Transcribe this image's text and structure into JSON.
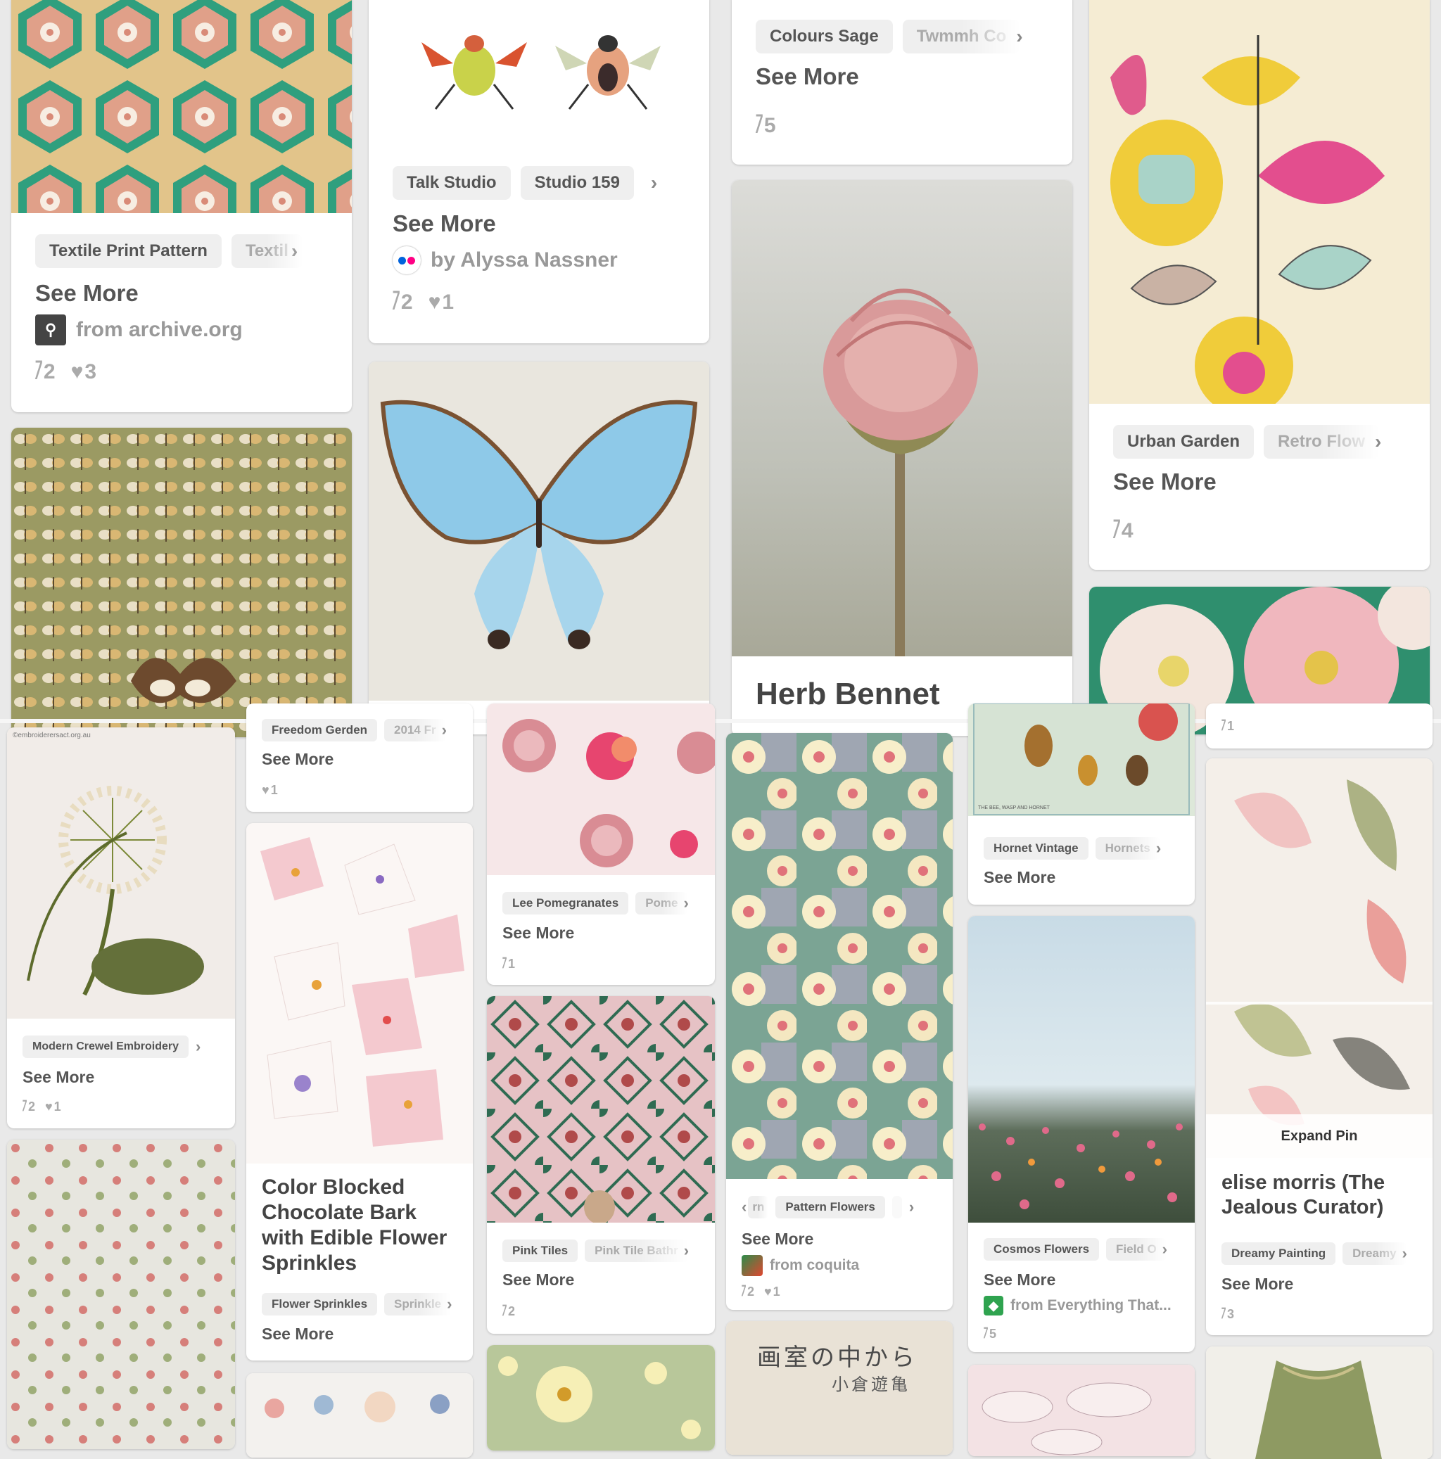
{
  "top": {
    "c1": {
      "chip1": "Textile Print Pattern",
      "chip2": "Textil",
      "see_more": "See More",
      "source": "from archive.org",
      "repins": "2",
      "likes": "3"
    },
    "c2": {
      "chip1": "Talk Studio",
      "chip2": "Studio 159",
      "see_more": "See More",
      "author": "by Alyssa Nassner",
      "repins": "2",
      "likes": "1"
    },
    "c3": {
      "chip1": "Colours Sage",
      "chip2": "Twmmh Co",
      "see_more": "See More",
      "repins": "5"
    },
    "c4": {
      "title": "Herb Bennet"
    },
    "c5": {
      "chip1": "Urban Garden",
      "chip2": "Retro Flow",
      "see_more": "See More",
      "repins": "4"
    }
  },
  "bottom": {
    "b1": {
      "watermark": "©embroiderersact.org.au",
      "chip1": "Modern Crewel Embroidery",
      "see_more": "See More",
      "repins": "2",
      "likes": "1"
    },
    "b2": {
      "chip1": "Freedom Gerden",
      "chip2": "2014 Fr",
      "see_more": "See More",
      "likes": "1"
    },
    "b3": {
      "title": "Color Blocked Chocolate Bark with Edible Flower Sprinkles",
      "chip1": "Flower Sprinkles",
      "chip2": "Sprinkle",
      "see_more": "See More"
    },
    "b4": {
      "chip1": "Lee Pomegranates",
      "chip2": "Pome",
      "see_more": "See More",
      "repins": "1"
    },
    "b5": {
      "chip1": "Pink Tiles",
      "chip2": "Pink Tile Bathr",
      "see_more": "See More",
      "repins": "2"
    },
    "b6": {
      "chip0": "rn",
      "chip1": "Pattern Flowers",
      "see_more": "See More",
      "source": "from coquita",
      "repins": "2",
      "likes": "1"
    },
    "b6img": {
      "text1": "画室の中から",
      "text2": "小倉遊亀"
    },
    "b7": {
      "caption": "THE BEE, WASP AND HORNET",
      "chip1": "Hornet Vintage",
      "chip2": "Hornets",
      "see_more": "See More"
    },
    "b8": {
      "chip1": "Cosmos Flowers",
      "chip2": "Field O",
      "see_more": "See More",
      "source": "from Everything That...",
      "repins": "5"
    },
    "b9": {
      "repins": "1"
    },
    "b10": {
      "expand": "Expand Pin",
      "title": "elise morris (The Jealous Curator)",
      "chip1": "Dreamy Painting",
      "chip2": "Dreamy",
      "see_more": "See More",
      "repins": "3"
    }
  },
  "icons": {
    "pin": "pin-icon",
    "heart": "heart-icon",
    "chevron": "chevron-right-icon",
    "flickr": "flickr-icon",
    "archive": "pin-source-icon"
  }
}
